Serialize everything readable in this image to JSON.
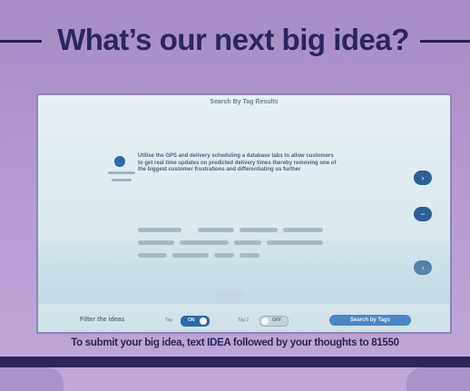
{
  "headline": "What’s our next big idea?",
  "screen": {
    "title": "Search By Tag Results",
    "idea_text": "Utilise the GPS and delivery scheduling a database tabs to allow customers to get real time updates on predicted delivery times thereby removing one of the biggest customer frustrations and differentiating us further",
    "side_buttons": [
      "›",
      "−",
      "›"
    ]
  },
  "filter": {
    "label": "Filter the ideas",
    "tag1_label": "Tag",
    "tag1_state": "ON",
    "tag2_label": "Tag 2",
    "tag2_state": "OFF",
    "search_button": "Search by Tags"
  },
  "footer_text": "To submit your big idea, text IDEA followed by your thoughts to 81550",
  "colors": {
    "headline": "#2b2560",
    "accent": "#2f6aa6",
    "screen_bg": "#e2edf2"
  }
}
